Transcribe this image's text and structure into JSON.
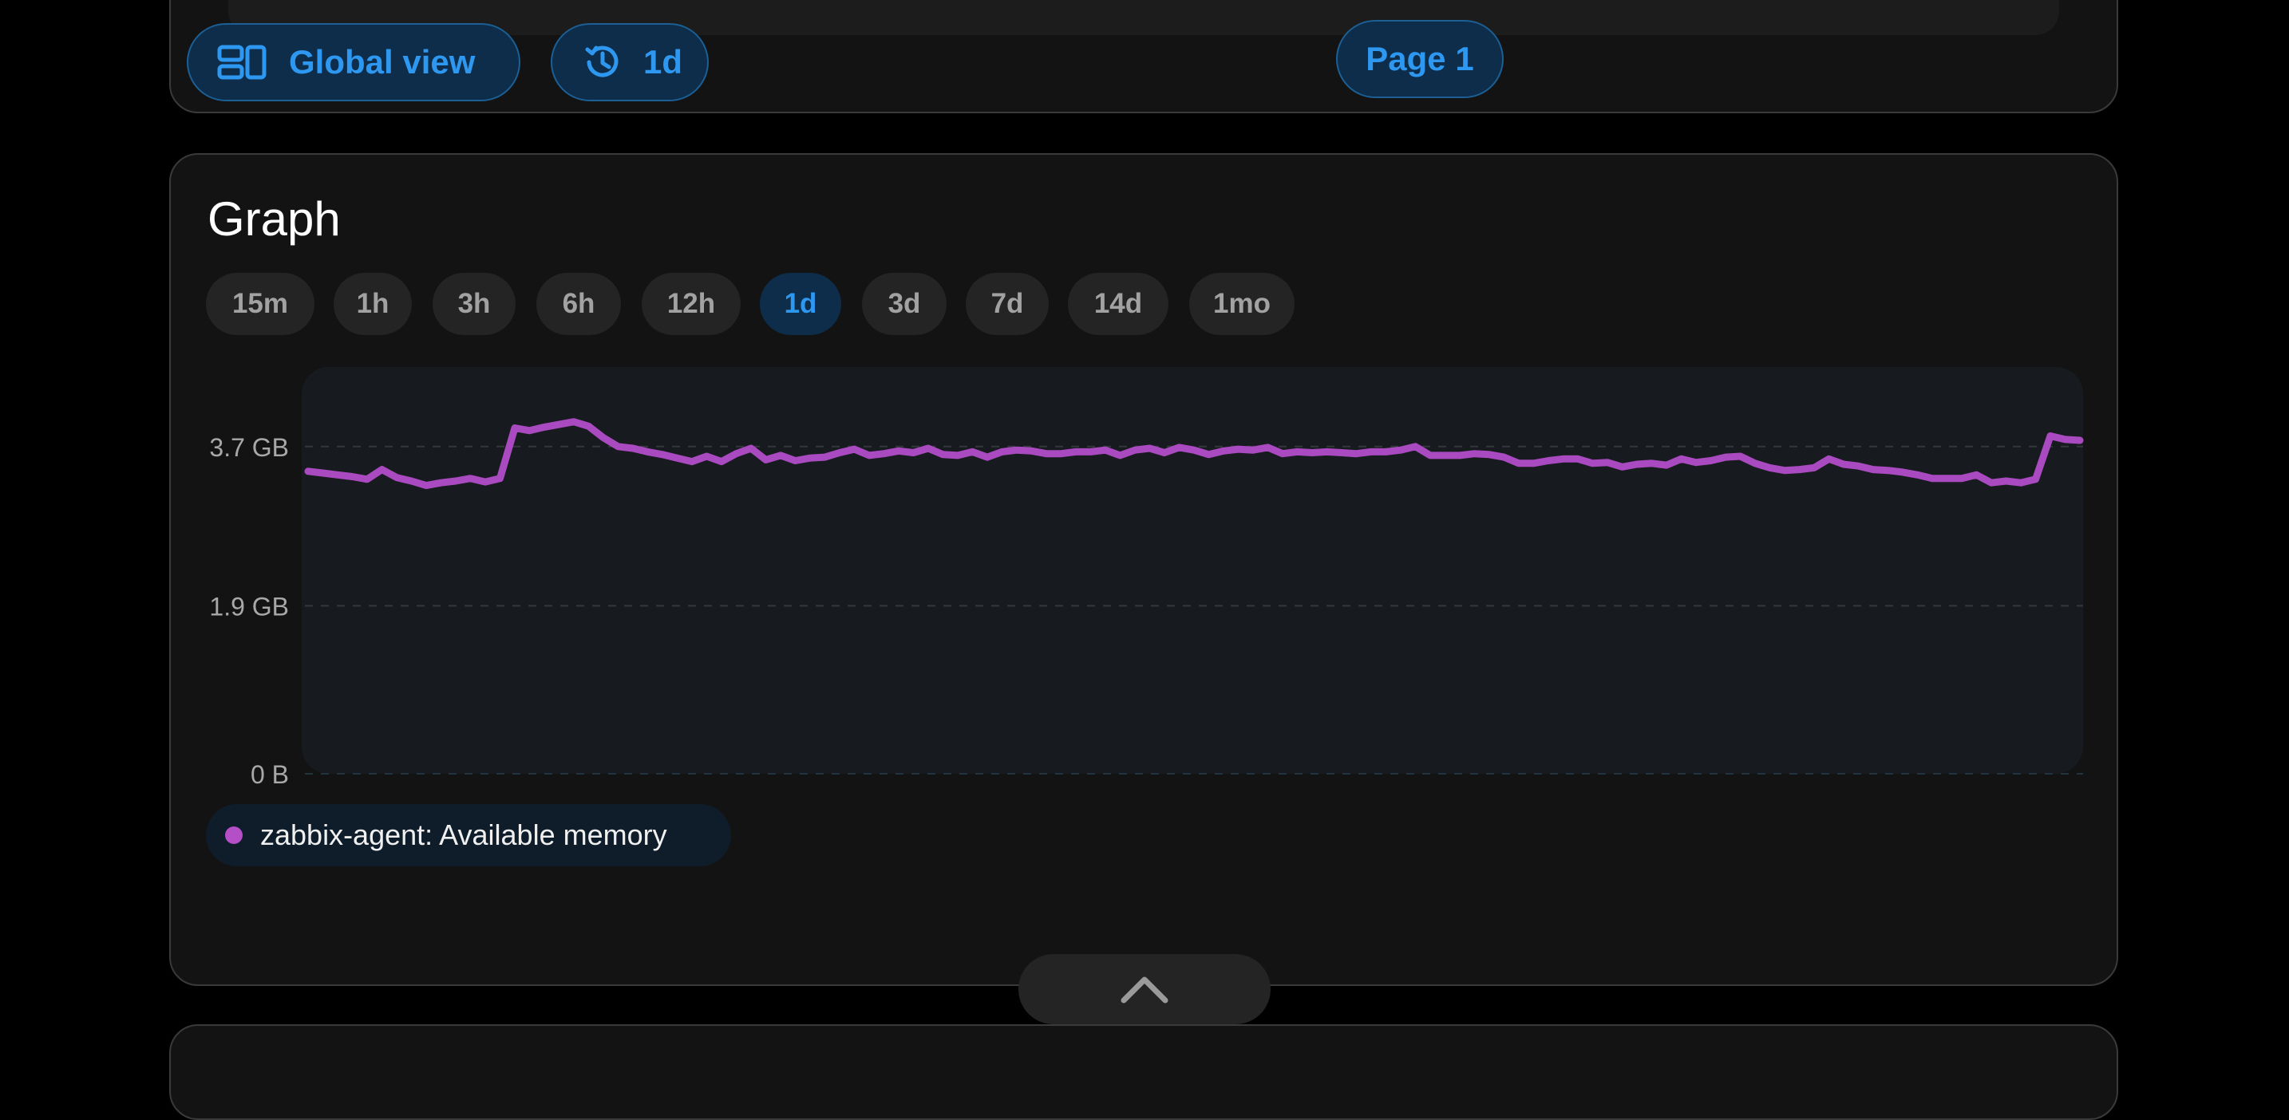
{
  "toolbar": {
    "global_view_label": "Global view",
    "time_range_label": "1d",
    "page_label": "Page 1"
  },
  "graph": {
    "title": "Graph",
    "ranges": [
      "15m",
      "1h",
      "3h",
      "6h",
      "12h",
      "1d",
      "3d",
      "7d",
      "14d",
      "1mo"
    ],
    "active_range": "1d",
    "legend_label": "zabbix-agent: Available memory"
  },
  "colors": {
    "accent": "#2e97f0",
    "series": "#a94ac0",
    "card_bg": "#131313"
  },
  "chart_data": {
    "type": "line",
    "yticks": [
      "3.7 GB",
      "1.9 GB",
      "0 B"
    ],
    "yaxis_ticks_gb": [
      3.7,
      1.9,
      0
    ],
    "ylim_gb": [
      0,
      4.6
    ],
    "grid": true,
    "series": [
      {
        "name": "zabbix-agent: Available memory",
        "unit": "GB",
        "values": [
          3.42,
          3.4,
          3.38,
          3.36,
          3.33,
          3.44,
          3.35,
          3.31,
          3.26,
          3.29,
          3.31,
          3.34,
          3.3,
          3.34,
          3.91,
          3.88,
          3.92,
          3.95,
          3.98,
          3.93,
          3.8,
          3.7,
          3.68,
          3.64,
          3.61,
          3.57,
          3.53,
          3.59,
          3.53,
          3.62,
          3.68,
          3.55,
          3.6,
          3.54,
          3.57,
          3.58,
          3.63,
          3.67,
          3.6,
          3.62,
          3.65,
          3.63,
          3.68,
          3.61,
          3.6,
          3.64,
          3.58,
          3.64,
          3.66,
          3.65,
          3.62,
          3.62,
          3.64,
          3.64,
          3.66,
          3.6,
          3.66,
          3.68,
          3.63,
          3.69,
          3.66,
          3.61,
          3.65,
          3.67,
          3.66,
          3.69,
          3.62,
          3.64,
          3.63,
          3.64,
          3.63,
          3.62,
          3.64,
          3.64,
          3.66,
          3.7,
          3.6,
          3.6,
          3.6,
          3.62,
          3.61,
          3.58,
          3.51,
          3.51,
          3.54,
          3.56,
          3.56,
          3.51,
          3.52,
          3.47,
          3.5,
          3.51,
          3.49,
          3.56,
          3.52,
          3.54,
          3.58,
          3.59,
          3.51,
          3.46,
          3.43,
          3.44,
          3.46,
          3.56,
          3.5,
          3.48,
          3.44,
          3.43,
          3.41,
          3.38,
          3.34,
          3.34,
          3.34,
          3.38,
          3.29,
          3.31,
          3.29,
          3.33,
          3.82,
          3.78,
          3.77
        ]
      }
    ]
  }
}
